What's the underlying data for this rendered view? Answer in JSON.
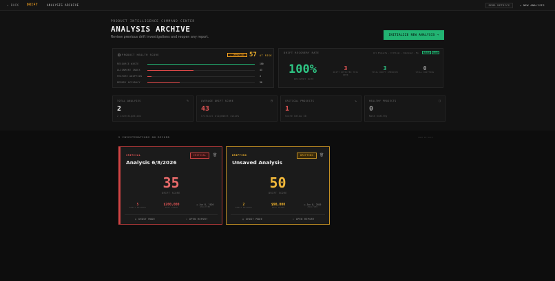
{
  "nav": {
    "back": "← BACK",
    "brand": "DRIFT",
    "archive": "ANALYSIS ARCHIVE",
    "demo_metrics": "DEMO METRICS",
    "new_analysis": "+ NEW ANALYSIS"
  },
  "header": {
    "eyebrow": "PRODUCT INTELLIGENCE COMMAND CENTER",
    "title": "ANALYSIS ARCHIVE",
    "subtitle": "Review previous drift investigations and reopen any report.",
    "init_button": "INITIALIZE NEW ANALYSIS →"
  },
  "health": {
    "label": "PRODUCT HEALTH SCORE",
    "trend": "↗ IMPROVING",
    "score": "57",
    "status": "AT RISK",
    "bars": [
      {
        "label": "RESOURCE WASTE",
        "value": "100",
        "pct": 100,
        "color": "#22b372"
      },
      {
        "label": "ALIGNMENT INDEX",
        "value": "43",
        "pct": 43,
        "color": "#e24a4a"
      },
      {
        "label": "FEATURE ADOPTION",
        "value": "4",
        "pct": 4,
        "color": "#e24a4a"
      },
      {
        "label": "MEMORY ACCURACY",
        "value": "30",
        "pct": 30,
        "color": "#e24a4a"
      }
    ]
  },
  "drift_rate": {
    "label": "DRIFT RECOVERY RATE",
    "legend": "All Projects · Critical · Improved · Mo",
    "tag1": "ALIGN",
    "tag2": "WEEK",
    "big_value": "100%",
    "big_label": "RECOVERY RATE",
    "stats": [
      {
        "value": "3",
        "label": "DRIFT DETECTED THIS WEEK",
        "color": "#e25555"
      },
      {
        "value": "3",
        "label": "TOTAL DRIFT IMPROVED",
        "color": "#2ec483"
      },
      {
        "value": "0",
        "label": "STILL DRIFTING",
        "color": "#9a9a9a"
      }
    ]
  },
  "metrics": [
    {
      "label": "TOTAL ANALYSES",
      "value": "2",
      "sub": "2 investigations",
      "icon": "✎",
      "color": "#f0f0f0"
    },
    {
      "label": "AVERAGE DRIFT SCORE",
      "value": "43",
      "sub": "Critical alignment issues",
      "icon": "◷",
      "color": "#e25555"
    },
    {
      "label": "CRITICAL PROJECTS",
      "value": "1",
      "sub": "Score below 30",
      "icon": "↘",
      "color": "#e25555"
    },
    {
      "label": "HEALTHY PROJECTS",
      "value": "0",
      "sub": "None healthy",
      "icon": "○",
      "color": "#9a9a9a"
    }
  ],
  "investigations": {
    "heading": "2 INVESTIGATIONS ON RECORD",
    "faint": "SORT BY DATE",
    "cards": [
      {
        "status": "CRITICAL",
        "title": "Analysis 6/8/2026",
        "badge": "CRITICAL",
        "score": "35",
        "score_label": "DRIFT SCORE",
        "stats": [
          {
            "value": "5",
            "label": "DRIFT MATCHES"
          },
          {
            "value": "$200,000",
            "label": "LOST VALUE"
          },
          {
            "value": "◷ Jun 8, 2026",
            "label": "ANALYZED"
          }
        ],
        "ghost": "◎ GHOST MODE",
        "open": "⇩ OPEN REPORT",
        "accent": "#e25555"
      },
      {
        "status": "DRIFTING",
        "title": "Unsaved Analysis",
        "badge": "DRIFTING",
        "score": "50",
        "score_label": "DRIFT SCORE",
        "stats": [
          {
            "value": "2",
            "label": "DRIFT MATCHES"
          },
          {
            "value": "$90,000",
            "label": "LOST VALUE"
          },
          {
            "value": "◷ Jun 8, 2026",
            "label": "ANALYZED"
          }
        ],
        "ghost": "◎ GHOST MODE",
        "open": "⇩ OPEN REPORT",
        "accent": "#f0b22c"
      }
    ]
  }
}
